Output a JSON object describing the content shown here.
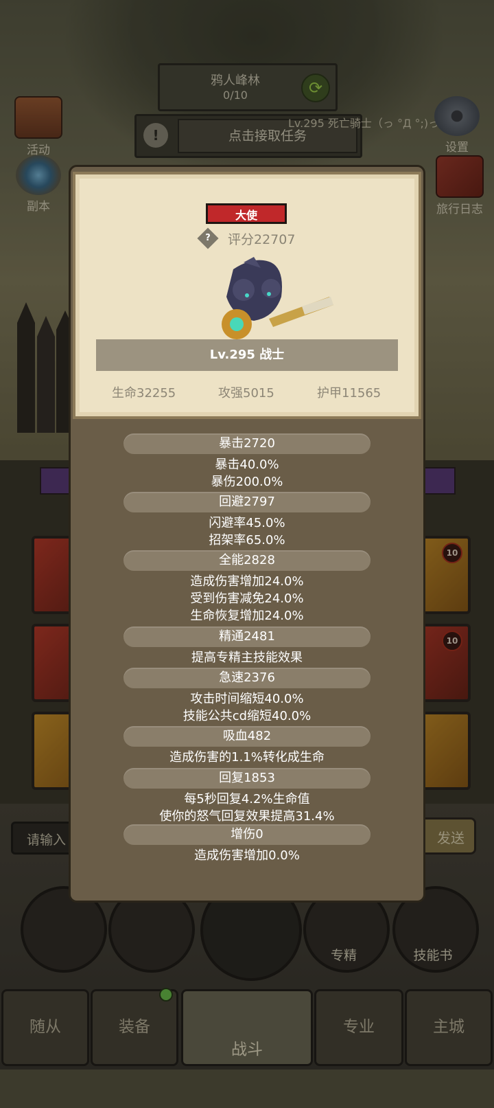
{
  "scene": {
    "zone_name": "鸦人峰林",
    "zone_progress": "0/10",
    "task_button": "点击接取任务",
    "enemy_text": "Lv.295 死亡骑士（っ °Д °;)っ",
    "side_left": [
      "活动",
      "副本"
    ],
    "side_right": [
      "设置",
      "旅行日志"
    ]
  },
  "chat": {
    "placeholder": "请输入",
    "send_label": "发送"
  },
  "skills": {
    "specialization": "专精",
    "skill_book": "技能书"
  },
  "bottom_tabs": [
    "随从",
    "装备",
    "战斗",
    "专业",
    "主城"
  ],
  "slots": {
    "badge": "10"
  },
  "hero_card": {
    "title_badge": "大使",
    "help_icon": "?",
    "score": "评分22707",
    "level_class": "Lv.295 战士",
    "hp": "生命32255",
    "attack": "攻强5015",
    "armor": "护甲11565"
  },
  "stats": [
    {
      "header": "暴击2720",
      "lines": [
        "暴击40.0%",
        "暴伤200.0%"
      ]
    },
    {
      "header": "回避2797",
      "lines": [
        "闪避率45.0%",
        "招架率65.0%"
      ]
    },
    {
      "header": "全能2828",
      "lines": [
        "造成伤害增加24.0%",
        "受到伤害减免24.0%",
        "生命恢复增加24.0%"
      ]
    },
    {
      "header": "精通2481",
      "lines": [
        "提高专精主技能效果"
      ]
    },
    {
      "header": "急速2376",
      "lines": [
        "攻击时间缩短40.0%",
        "技能公共cd缩短40.0%"
      ]
    },
    {
      "header": "吸血482",
      "lines": [
        "造成伤害的1.1%转化成生命"
      ]
    },
    {
      "header": "回复1853",
      "lines": [
        "每5秒回复4.2%生命值",
        "使你的怒气回复效果提高31.4%"
      ]
    },
    {
      "header": "增伤0",
      "lines": [
        "造成伤害增加0.0%"
      ]
    }
  ],
  "colors": {
    "title_badge": "#c0282a",
    "card_background": "#ede2c5",
    "modal_background": "#6a5d48",
    "stat_pill": "#8a7e6a"
  },
  "icons": [
    "refresh-icon",
    "alert-icon",
    "help-icon",
    "hero-portrait"
  ]
}
